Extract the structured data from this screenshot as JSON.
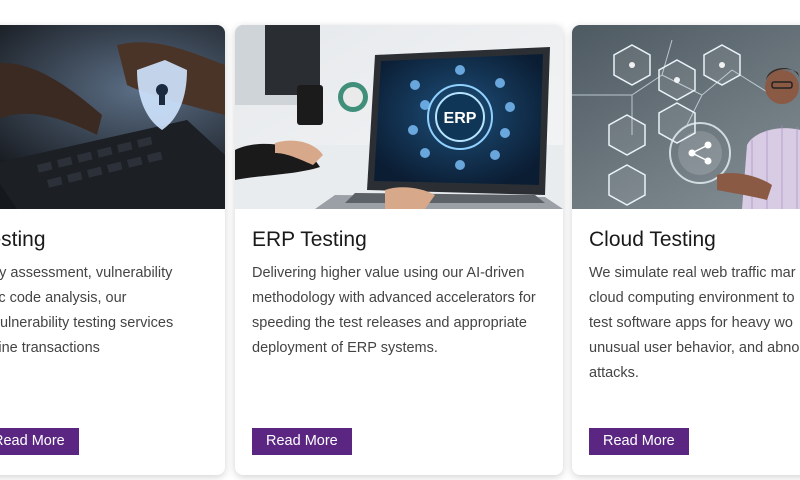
{
  "cards": [
    {
      "title": "Testing",
      "lines": [
        "urity assessment, vulnerability",
        "tatic code analysis, our",
        "& vulnerability testing services",
        "online transactions"
      ],
      "button": "Read More",
      "image_icon": "security-shield-lock-icon"
    },
    {
      "title": "ERP Testing",
      "lines": [
        "Delivering higher value using our AI-driven",
        "methodology with advanced accelerators for",
        "speeding the test releases and appropriate",
        "deployment of ERP systems."
      ],
      "button": "Read More",
      "image_label": "ERP",
      "image_icon": "laptop-erp-icon"
    },
    {
      "title": "Cloud Testing",
      "lines": [
        "We simulate real web traffic mar",
        "cloud computing environment to",
        "test software apps for heavy wo",
        "unusual user behavior, and abno",
        "attacks."
      ],
      "button": "Read More",
      "image_icon": "cloud-network-icon"
    }
  ],
  "colors": {
    "button_bg": "#5a2682",
    "button_text": "#ffffff",
    "title": "#1a1a1a",
    "body_text": "#444444"
  }
}
